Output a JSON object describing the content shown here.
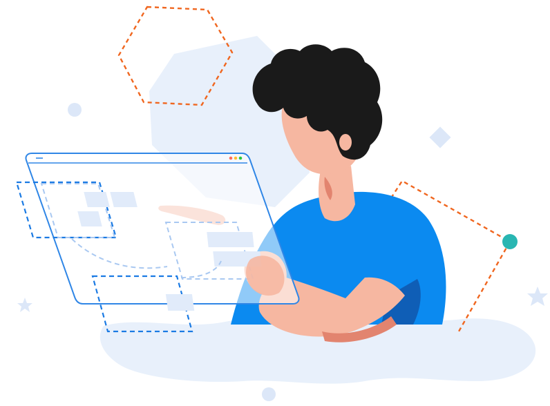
{
  "illustration": {
    "subject": "person-interacting-with-transparent-browser-window",
    "icons": [
      "hexagon-outline-icon",
      "diamond-icon",
      "star-icon",
      "dot-icon",
      "browser-window-icon"
    ],
    "colors": {
      "primary_blue": "#1a86ec",
      "shirt_blue": "#0b8af0",
      "shirt_shadow": "#0f5eb6",
      "accent_orange": "#f0661f",
      "teal_dot": "#29b6b2",
      "hair": "#1a1a1a",
      "skin": "#f6b7a1",
      "skin_shadow": "#e2846f",
      "pale_blue": "#e8f0fb",
      "window_panel": "#e1ebfa",
      "window_dot_red": "#ff6b5b",
      "window_dot_yellow": "#ffbd2e",
      "window_dot_green": "#2bc840"
    }
  }
}
